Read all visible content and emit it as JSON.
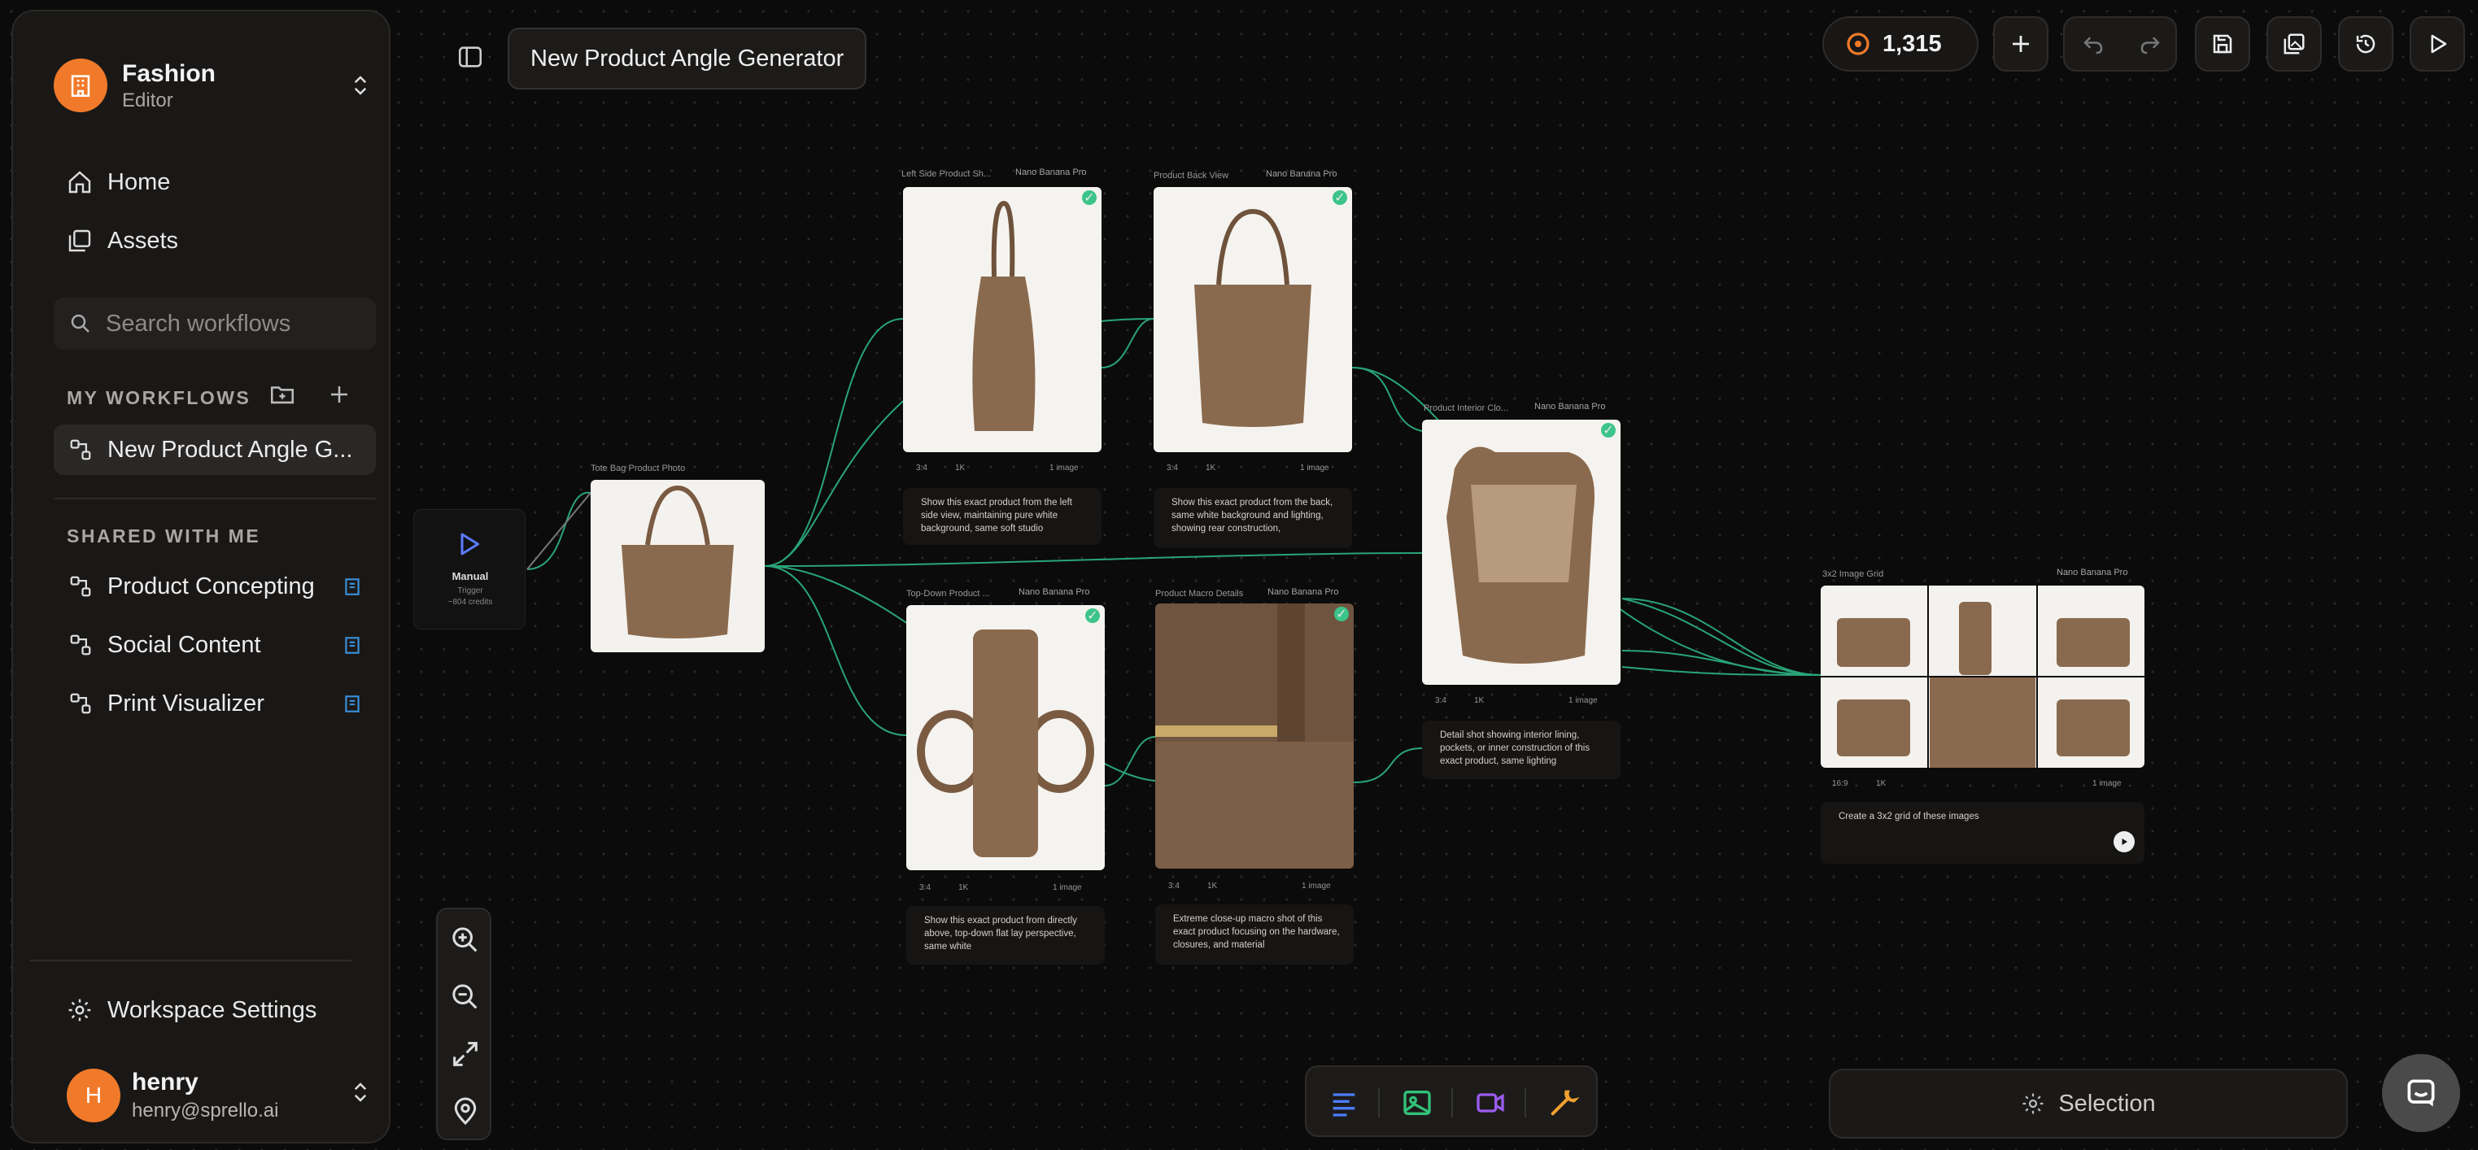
{
  "workspace": {
    "name": "Fashion",
    "role": "Editor"
  },
  "nav": {
    "home": "Home",
    "assets": "Assets"
  },
  "search": {
    "placeholder": "Search workflows"
  },
  "my_workflows": {
    "title": "MY WORKFLOWS",
    "items": [
      "New Product Angle G..."
    ]
  },
  "shared": {
    "title": "SHARED WITH ME",
    "items": [
      "Product Concepting",
      "Social Content",
      "Print Visualizer"
    ]
  },
  "settings_label": "Workspace Settings",
  "user": {
    "initial": "H",
    "name": "henry",
    "email": "henry@sprello.ai"
  },
  "header": {
    "title": "New Product Angle Generator",
    "credits": "1,315"
  },
  "bottom": {
    "selection_label": "Selection"
  },
  "canvas": {
    "trigger": {
      "title": "Manual",
      "sub": "Trigger",
      "credits": "~804 credits"
    },
    "source": {
      "label": "Tote Bag Product Photo"
    },
    "nodes": [
      {
        "label": "Left Side Product Sh...",
        "model": "Nano Banana Pro",
        "ratio": "3:4",
        "res": "1K",
        "count": "1 image",
        "prompt": "Show this exact product from the left side view, maintaining pure white background, same soft studio"
      },
      {
        "label": "Product Back View",
        "model": "Nano Banana Pro",
        "ratio": "3:4",
        "res": "1K",
        "count": "1 image",
        "prompt": "Show this exact product from the back, same white background and lighting, showing rear construction,"
      },
      {
        "label": "Top-Down Product ...",
        "model": "Nano Banana Pro",
        "ratio": "3:4",
        "res": "1K",
        "count": "1 image",
        "prompt": "Show this exact product from directly above, top-down flat lay perspective, same white"
      },
      {
        "label": "Product Macro Details",
        "model": "Nano Banana Pro",
        "ratio": "3:4",
        "res": "1K",
        "count": "1 image",
        "prompt": "Extreme close-up macro shot of this exact product focusing on the hardware, closures, and material"
      },
      {
        "label": "Product Interior Clo...",
        "model": "Nano Banana Pro",
        "ratio": "3:4",
        "res": "1K",
        "count": "1 image",
        "prompt": "Detail shot showing interior lining, pockets, or inner construction of this exact product, same lighting"
      },
      {
        "label": "3x2 Image Grid",
        "model": "Nano Banana Pro",
        "ratio": "16:9",
        "res": "1K",
        "count": "1 image",
        "prompt": "Create a 3x2 grid of these images"
      }
    ]
  },
  "colors": {
    "accent": "#f07a2a",
    "edge": "#33d399",
    "port": "#5c7cff",
    "leather": "#8a6a4e"
  }
}
